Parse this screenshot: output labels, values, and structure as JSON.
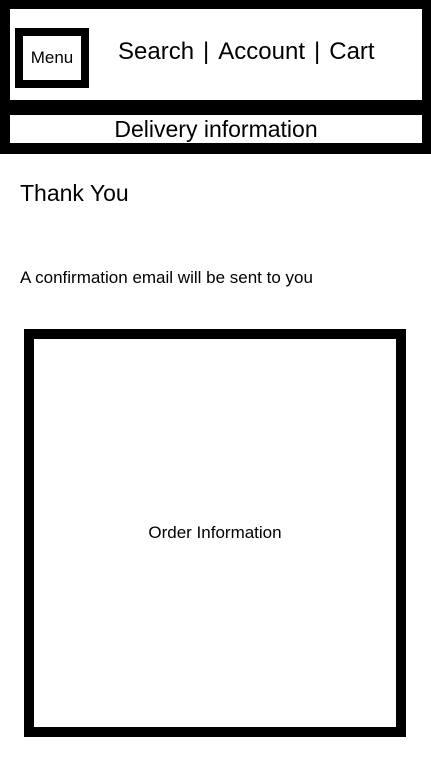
{
  "header": {
    "menu_label": "Menu",
    "nav": {
      "search": "Search",
      "account": "Account",
      "cart": "Cart",
      "separator": "|"
    },
    "step_title": "Delivery information"
  },
  "main": {
    "title": "Thank You",
    "confirmation_text": "A confirmation email will be sent to you",
    "order_panel_label": "Order Information"
  },
  "colors": {
    "frame": "#000000",
    "background": "#ffffff",
    "text": "#000000"
  }
}
